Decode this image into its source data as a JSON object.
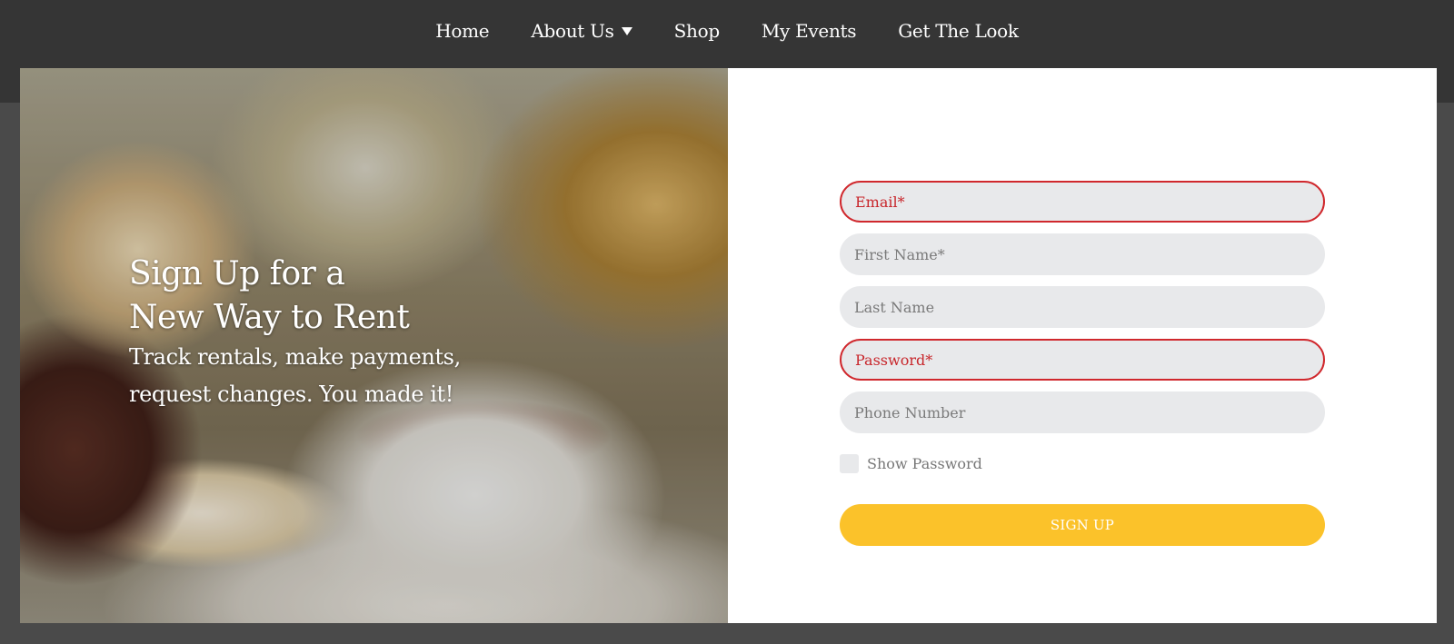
{
  "nav": {
    "items": [
      {
        "label": "Home"
      },
      {
        "label": "About Us",
        "has_dropdown": true
      },
      {
        "label": "Shop"
      },
      {
        "label": "My Events"
      },
      {
        "label": "Get The Look"
      }
    ]
  },
  "hero": {
    "title": "Sign Up for a New Way to Rent",
    "subtitle": "Track rentals, make payments, request changes. You made it!"
  },
  "form": {
    "email_placeholder": "Email*",
    "first_name_placeholder": "First Name*",
    "last_name_placeholder": "Last Name",
    "password_placeholder": "Password*",
    "phone_placeholder": "Phone Number",
    "show_password_label": "Show Password",
    "show_password_checked": false,
    "submit_label": "SIGN UP"
  },
  "colors": {
    "nav_bg": "#353535",
    "page_bg": "#4a4a4a",
    "field_bg": "#e8e9eb",
    "error": "#d0282d",
    "accent": "#fbc22a"
  }
}
